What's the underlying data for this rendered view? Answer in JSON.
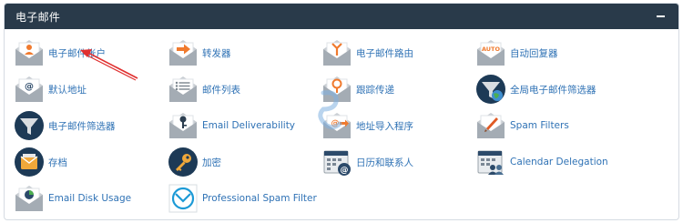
{
  "panel": {
    "title": "电子邮件",
    "collapse_icon": "minus-icon"
  },
  "items": [
    {
      "label": "电子邮件帐户",
      "icon": "email-account-icon"
    },
    {
      "label": "转发器",
      "icon": "forwarder-icon"
    },
    {
      "label": "电子邮件路由",
      "icon": "email-routing-icon"
    },
    {
      "label": "自动回复器",
      "icon": "autoresponder-icon"
    },
    {
      "label": "默认地址",
      "icon": "default-address-icon"
    },
    {
      "label": "邮件列表",
      "icon": "mailing-list-icon"
    },
    {
      "label": "跟踪传递",
      "icon": "track-delivery-icon"
    },
    {
      "label": "全局电子邮件筛选器",
      "icon": "global-filter-icon"
    },
    {
      "label": "电子邮件筛选器",
      "icon": "email-filter-icon"
    },
    {
      "label": "Email Deliverability",
      "icon": "deliverability-icon"
    },
    {
      "label": "地址导入程序",
      "icon": "address-importer-icon"
    },
    {
      "label": "Spam Filters",
      "icon": "spam-filter-icon"
    },
    {
      "label": "存档",
      "icon": "archive-icon"
    },
    {
      "label": "加密",
      "icon": "encryption-icon"
    },
    {
      "label": "日历和联系人",
      "icon": "calendar-contacts-icon"
    },
    {
      "label": "Calendar Delegation",
      "icon": "calendar-delegation-icon"
    },
    {
      "label": "Email Disk Usage",
      "icon": "disk-usage-icon"
    },
    {
      "label": "Professional Spam Filter",
      "icon": "pro-spam-filter-icon"
    }
  ],
  "colors": {
    "header_bg": "#293a4a",
    "link": "#2f72b5",
    "envelope": "#9aa3ab",
    "accent_orange": "#f07a2e",
    "dark_circle": "#1d3a56",
    "annotation_arrow": "#e03030"
  }
}
